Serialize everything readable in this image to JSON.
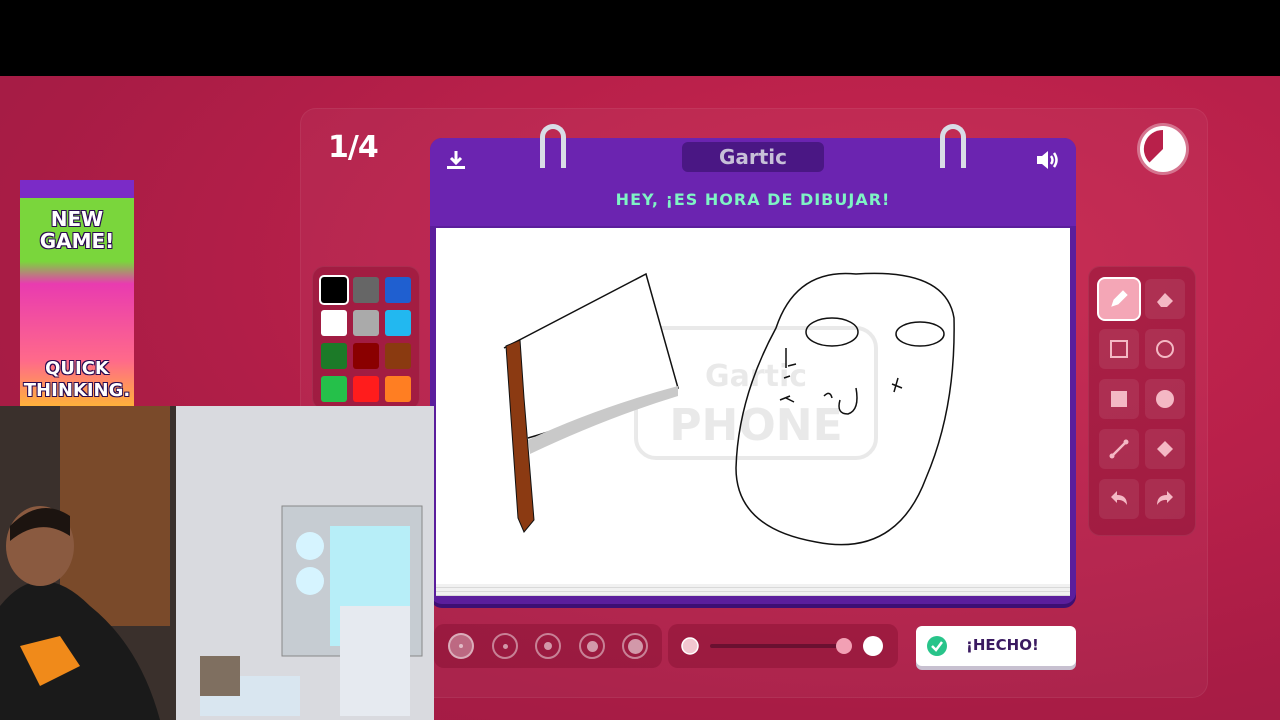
{
  "round": {
    "counter": "1/4"
  },
  "notebook": {
    "logo_text": "Gartic",
    "prompt": "HEY, ¡ES HORA DE DIBUJAR!",
    "watermark_top": "Gartic",
    "watermark_bottom": "PHONE"
  },
  "palette": {
    "colors": [
      "#000000",
      "#666666",
      "#1f5fd0",
      "#ffffff",
      "#aaaaaa",
      "#22b8f0",
      "#1c7a28",
      "#8a0000",
      "#8a3a10",
      "#25c04a",
      "#ff1c1c",
      "#ff7e22"
    ],
    "selected": "#000000"
  },
  "tools": {
    "items": [
      "pencil-icon",
      "eraser-icon",
      "rectangle-outline-icon",
      "ellipse-outline-icon",
      "rectangle-fill-icon",
      "ellipse-fill-icon",
      "line-icon",
      "bucket-icon",
      "undo-icon",
      "redo-icon"
    ],
    "selected": "pencil-icon"
  },
  "brush": {
    "sizes_count": 5,
    "selected_size_index": 0,
    "opacity_fraction": 1.0
  },
  "done_button": {
    "label": "¡HECHO!"
  },
  "ad": {
    "line1": "NEW GAME!",
    "line2": "QUICK THINKING."
  },
  "colors": {
    "background": "#b8204a",
    "notebook": "#5b1e9c",
    "prompt_text": "#7ff3c5"
  }
}
